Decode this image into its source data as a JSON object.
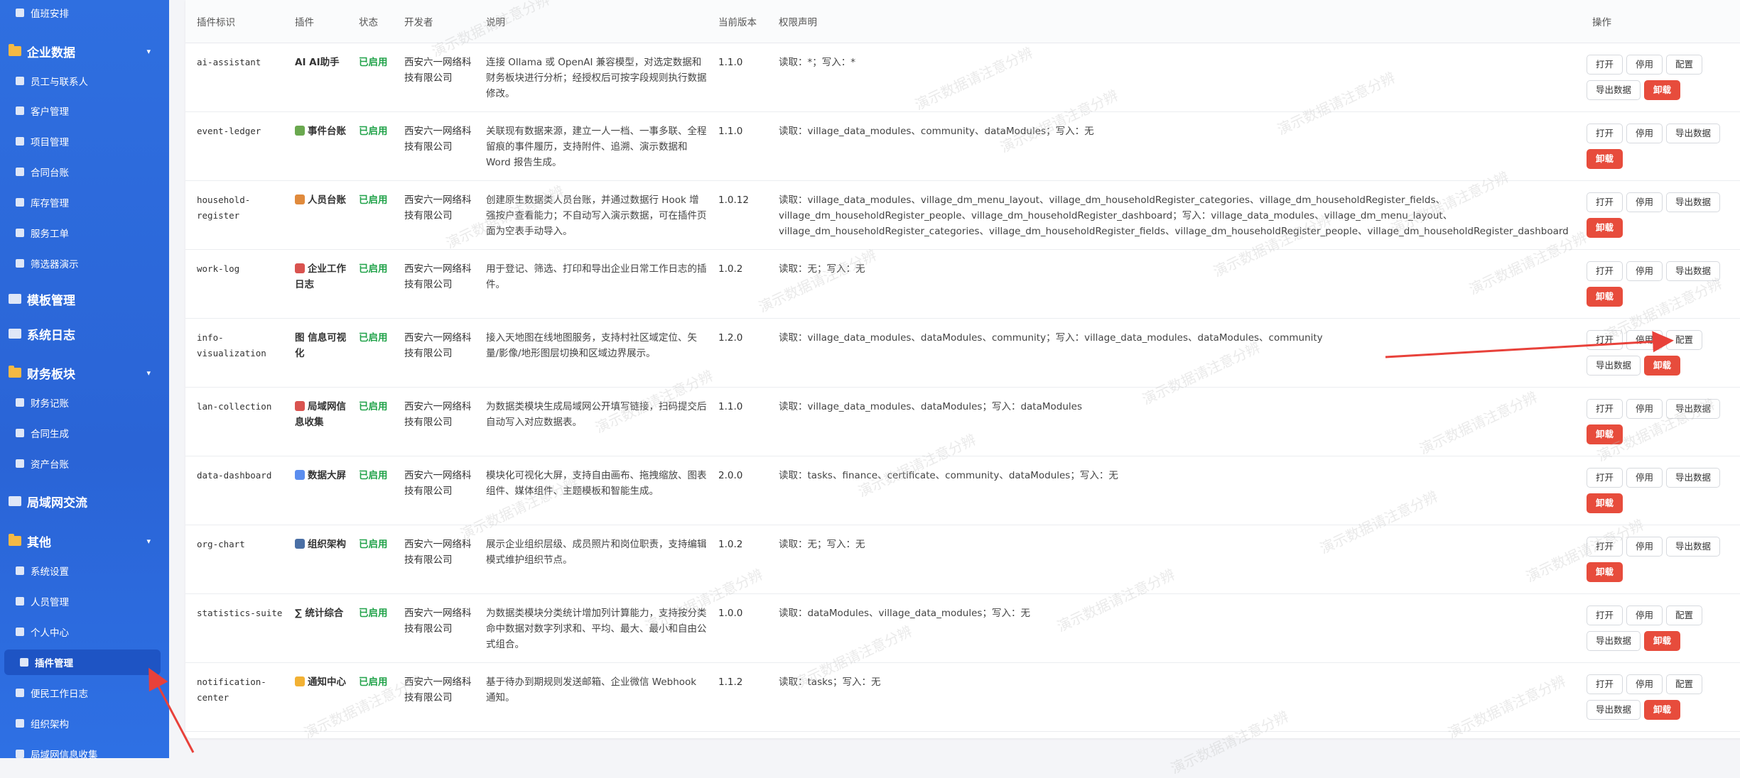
{
  "sidebar": {
    "items": [
      {
        "label": "值班安排",
        "level": "sub",
        "icon": "calendar-icon"
      },
      {
        "label": "企业数据",
        "level": "top",
        "icon": "folder-icon",
        "expandable": true
      },
      {
        "label": "员工与联系人",
        "level": "sub",
        "icon": "contacts-icon"
      },
      {
        "label": "客户管理",
        "level": "sub",
        "icon": "star-icon"
      },
      {
        "label": "项目管理",
        "level": "sub",
        "icon": "pin-icon"
      },
      {
        "label": "合同台账",
        "level": "sub",
        "icon": "document-icon"
      },
      {
        "label": "库存管理",
        "level": "sub",
        "icon": "box-icon"
      },
      {
        "label": "服务工单",
        "level": "sub",
        "icon": "headset-icon"
      },
      {
        "label": "筛选器演示",
        "level": "sub",
        "icon": "pencil-icon"
      },
      {
        "label": "模板管理",
        "level": "top",
        "icon": "document-icon"
      },
      {
        "label": "系统日志",
        "level": "top",
        "icon": "document-icon"
      },
      {
        "label": "财务板块",
        "level": "top",
        "icon": "folder-icon",
        "expandable": true
      },
      {
        "label": "财务记账",
        "level": "sub",
        "icon": "money-bag-icon"
      },
      {
        "label": "合同生成",
        "level": "sub",
        "icon": "document-icon"
      },
      {
        "label": "资产台账",
        "level": "sub",
        "icon": "document-icon"
      },
      {
        "label": "局域网交流",
        "level": "top",
        "icon": "chat-icon"
      },
      {
        "label": "其他",
        "level": "top",
        "icon": "folder-icon",
        "expandable": true
      },
      {
        "label": "系统设置",
        "level": "sub",
        "icon": "gear-icon"
      },
      {
        "label": "人员管理",
        "level": "sub",
        "icon": "person-icon"
      },
      {
        "label": "个人中心",
        "level": "sub",
        "icon": "user-card-icon"
      },
      {
        "label": "插件管理",
        "level": "sub",
        "icon": "puzzle-icon",
        "active": true
      },
      {
        "label": "便民工作日志",
        "level": "sub",
        "icon": "document-icon"
      },
      {
        "label": "组织架构",
        "level": "sub",
        "icon": "org-icon"
      },
      {
        "label": "局域网信息收集",
        "level": "sub",
        "icon": "document-icon"
      }
    ]
  },
  "table": {
    "headers": [
      "插件标识",
      "插件",
      "状态",
      "开发者",
      "说明",
      "当前版本",
      "权限声明",
      "操作"
    ],
    "rows": [
      {
        "id": "ai-assistant",
        "name": "AI AI助手",
        "icon": "ai-icon",
        "status": "已启用",
        "developer": "西安六一网络科技有限公司",
        "desc": "连接 Ollama 或 OpenAI 兼容模型，对选定数据和财务板块进行分析；经授权后可按字段规则执行数据修改。",
        "version": "1.1.0",
        "perm": "读取：*；写入：*",
        "actions": [
          "打开",
          "停用",
          "配置",
          "导出数据",
          "卸载"
        ]
      },
      {
        "id": "event-ledger",
        "name": "事件台账",
        "icon": "books-icon",
        "status": "已启用",
        "developer": "西安六一网络科技有限公司",
        "desc": "关联现有数据来源，建立一人一档、一事多联、全程留痕的事件履历，支持附件、追溯、演示数据和 Word 报告生成。",
        "version": "1.1.0",
        "perm": "读取：village_data_modules、community、dataModules；写入：无",
        "actions": [
          "打开",
          "停用",
          "导出数据",
          "卸载"
        ]
      },
      {
        "id": "household-register",
        "name": "人员台账",
        "icon": "house-icon",
        "status": "已启用",
        "developer": "西安六一网络科技有限公司",
        "desc": "创建原生数据类人员台账，并通过数据行 Hook 增强按户查看能力；不自动写入演示数据，可在插件页面为空表手动导入。",
        "version": "1.0.12",
        "perm": "读取：village_data_modules、village_dm_menu_layout、village_dm_householdRegister_categories、village_dm_householdRegister_fields、village_dm_householdRegister_people、village_dm_householdRegister_dashboard；写入：village_data_modules、village_dm_menu_layout、village_dm_householdRegister_categories、village_dm_householdRegister_fields、village_dm_householdRegister_people、village_dm_householdRegister_dashboard",
        "actions": [
          "打开",
          "停用",
          "导出数据",
          "卸载"
        ]
      },
      {
        "id": "work-log",
        "name": "企业工作日志",
        "icon": "memo-icon",
        "status": "已启用",
        "developer": "西安六一网络科技有限公司",
        "desc": "用于登记、筛选、打印和导出企业日常工作日志的插件。",
        "version": "1.0.2",
        "perm": "读取：无；写入：无",
        "actions": [
          "打开",
          "停用",
          "导出数据",
          "卸载"
        ]
      },
      {
        "id": "info-visualization",
        "name": "图 信息可视化",
        "icon": "",
        "status": "已启用",
        "developer": "西安六一网络科技有限公司",
        "desc": "接入天地图在线地图服务，支持村社区域定位、矢量/影像/地形图层切换和区域边界展示。",
        "version": "1.2.0",
        "perm": "读取：village_data_modules、dataModules、community；写入：village_data_modules、dataModules、community",
        "actions": [
          "打开",
          "停用",
          "配置",
          "导出数据",
          "卸载"
        ]
      },
      {
        "id": "lan-collection",
        "name": "局域网信息收集",
        "icon": "memo-icon",
        "status": "已启用",
        "developer": "西安六一网络科技有限公司",
        "desc": "为数据类模块生成局域网公开填写链接，扫码提交后自动写入对应数据表。",
        "version": "1.1.0",
        "perm": "读取：village_data_modules、dataModules；写入：dataModules",
        "actions": [
          "打开",
          "停用",
          "导出数据",
          "卸载"
        ]
      },
      {
        "id": "data-dashboard",
        "name": "数据大屏",
        "icon": "chart-icon",
        "status": "已启用",
        "developer": "西安六一网络科技有限公司",
        "desc": "模块化可视化大屏，支持自由画布、拖拽缩放、图表组件、媒体组件、主题模板和智能生成。",
        "version": "2.0.0",
        "perm": "读取：tasks、finance、certificate、community、dataModules；写入：无",
        "actions": [
          "打开",
          "停用",
          "导出数据",
          "卸载"
        ]
      },
      {
        "id": "org-chart",
        "name": "组织架构",
        "icon": "building-icon",
        "status": "已启用",
        "developer": "西安六一网络科技有限公司",
        "desc": "展示企业组织层级、成员照片和岗位职责，支持编辑模式维护组织节点。",
        "version": "1.0.2",
        "perm": "读取：无；写入：无",
        "actions": [
          "打开",
          "停用",
          "导出数据",
          "卸载"
        ]
      },
      {
        "id": "statistics-suite",
        "name": "∑ 统计综合",
        "icon": "",
        "status": "已启用",
        "developer": "西安六一网络科技有限公司",
        "desc": "为数据类模块分类统计增加列计算能力，支持按分类命中数据对数字列求和、平均、最大、最小和自由公式组合。",
        "version": "1.0.0",
        "perm": "读取：dataModules、village_data_modules；写入：无",
        "actions": [
          "打开",
          "停用",
          "配置",
          "导出数据",
          "卸载"
        ]
      },
      {
        "id": "notification-center",
        "name": "通知中心",
        "icon": "bell-icon",
        "status": "已启用",
        "developer": "西安六一网络科技有限公司",
        "desc": "基于待办到期规则发送邮箱、企业微信 Webhook 通知。",
        "version": "1.1.2",
        "perm": "读取：tasks；写入：无",
        "actions": [
          "打开",
          "停用",
          "配置",
          "导出数据",
          "卸载"
        ]
      }
    ]
  },
  "watermark_text": "演示数据请注意分辨",
  "colors": {
    "sidebar": "#2f6fe0",
    "active": "#1e54c4",
    "enabled": "#22a34a",
    "danger": "#e74c3c",
    "arrow": "#e8413a"
  }
}
